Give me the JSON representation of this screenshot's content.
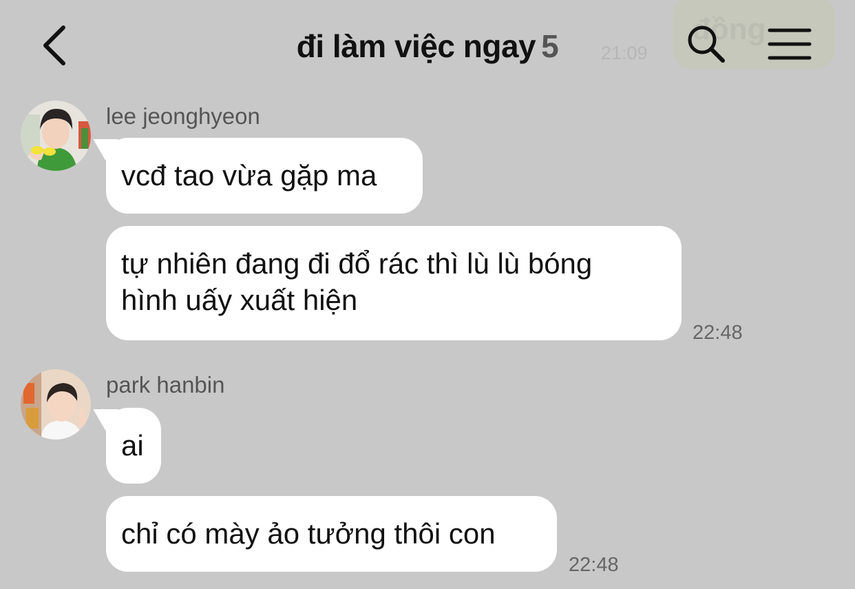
{
  "header": {
    "title": "đi làm việc ngay",
    "member_count": "5",
    "ghost_time": "21:09",
    "ghost_text": "đồng"
  },
  "messages": [
    {
      "sender": "lee jeonghyeon",
      "bubbles": [
        "vcđ tao vừa gặp ma",
        "tự nhiên đang đi đổ rác thì lù lù bóng\nhình uấy xuất hiện"
      ],
      "time": "22:48"
    },
    {
      "sender": "park hanbin",
      "bubbles": [
        "ai",
        "chỉ có mày ảo tưởng thôi con"
      ],
      "time": "22:48"
    }
  ],
  "colors": {
    "background": "#c8c8c8",
    "bubble": "#ffffff"
  },
  "icons": [
    "back-chevron-icon",
    "search-icon",
    "menu-icon"
  ]
}
